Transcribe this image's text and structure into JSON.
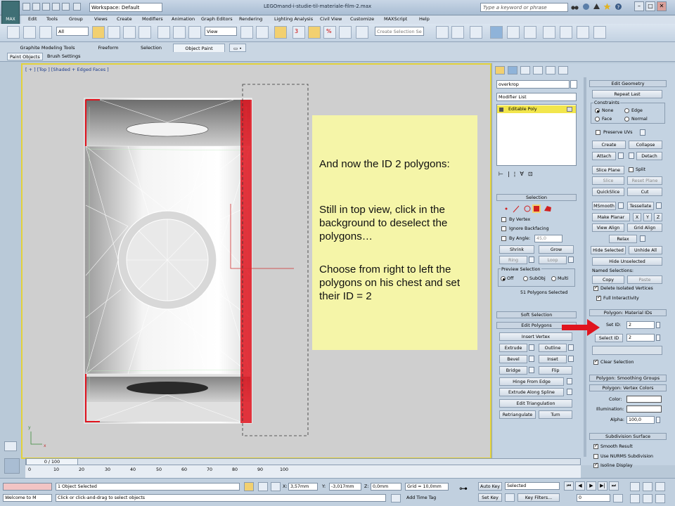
{
  "window": {
    "title": "LEGOmand-i-studie-til-materiale-film-2.max",
    "workspace": "Workspace: Default",
    "search_placeholder": "Type a keyword or phrase",
    "app_label": "MAX"
  },
  "menu": [
    "Edit",
    "Tools",
    "Group",
    "Views",
    "Create",
    "Modifiers",
    "Animation",
    "Graph Editors",
    "Rendering",
    "Lighting Analysis",
    "Civil View",
    "Customize",
    "MAXScript",
    "Help"
  ],
  "toolbar": {
    "filter": "All",
    "coord_system": "View",
    "selection_set_placeholder": "Create Selection Se",
    "snap_value": "3",
    "percent_snap": "%"
  },
  "ribbon": {
    "tabs": [
      "Graphite Modeling Tools",
      "Freeform",
      "Selection",
      "Object Paint"
    ],
    "active_tab": "Object Paint",
    "subtabs": [
      "Paint Objects",
      "Brush Settings"
    ]
  },
  "viewport": {
    "label": "[ + ] [Top ] [Shaded + Edged Faces ]"
  },
  "note": {
    "p1": "And now the ID 2 polygons:",
    "p2": "Still in top view, click in the background to deselect the polygons…",
    "p3": "Choose from right to left the polygons on his chest and set their ID = 2"
  },
  "command_panel": {
    "object_name": "overkrop",
    "modifier_list": "Modifier List",
    "stack_item": "Editable Poly",
    "selection": {
      "title": "Selection",
      "by_vertex": "By Vertex",
      "ignore_backfacing": "Ignore Backfacing",
      "by_angle": "By Angle:",
      "angle_value": "45,0",
      "shrink": "Shrink",
      "grow": "Grow",
      "ring": "Ring",
      "loop": "Loop",
      "preview_title": "Preview Selection",
      "preview_off": "Off",
      "preview_subobj": "SubObj",
      "preview_multi": "Multi",
      "status": "51 Polygons Selected"
    },
    "soft_selection": "Soft Selection",
    "edit_polygons": {
      "title": "Edit Polygons",
      "insert_vertex": "Insert Vertex",
      "extrude": "Extrude",
      "outline": "Outline",
      "bevel": "Bevel",
      "inset": "Inset",
      "bridge": "Bridge",
      "flip": "Flip",
      "hinge": "Hinge From Edge",
      "extrude_spline": "Extrude Along Spline",
      "edit_triangulation": "Edit Triangulation",
      "retriangulate": "Retriangulate",
      "turn": "Turn"
    }
  },
  "rollouts": {
    "edit_geometry": {
      "title": "Edit Geometry",
      "repeat_last": "Repeat Last",
      "constraints": "Constraints",
      "none": "None",
      "edge": "Edge",
      "face": "Face",
      "normal": "Normal",
      "preserve_uvs": "Preserve UVs",
      "create": "Create",
      "collapse": "Collapse",
      "attach": "Attach",
      "detach": "Detach",
      "slice_plane": "Slice Plane",
      "split": "Split",
      "slice": "Slice",
      "reset_plane": "Reset Plane",
      "quickslice": "QuickSlice",
      "cut": "Cut",
      "msmooth": "MSmooth",
      "tessellate": "Tessellate",
      "make_planar": "Make Planar",
      "x": "X",
      "y": "Y",
      "z": "Z",
      "view_align": "View Align",
      "grid_align": "Grid Align",
      "relax": "Relax",
      "hide_selected": "Hide Selected",
      "unhide_all": "Unhide All",
      "hide_unselected": "Hide Unselected",
      "named_selections": "Named Selections:",
      "copy": "Copy",
      "paste": "Paste",
      "delete_isolated": "Delete Isolated Vertices",
      "full_interactivity": "Full Interactivity"
    },
    "material_ids": {
      "title": "Polygon: Material IDs",
      "set_id": "Set ID:",
      "set_id_value": "2",
      "select_id": "Select ID",
      "select_id_value": "2",
      "clear_selection": "Clear Selection"
    },
    "smoothing_groups": "Polygon: Smoothing Groups",
    "vertex_colors": {
      "title": "Polygon: Vertex Colors",
      "color": "Color:",
      "illumination": "Illumination:",
      "alpha": "Alpha:",
      "alpha_value": "100,0"
    },
    "subdivision": {
      "title": "Subdivision Surface",
      "smooth_result": "Smooth Result",
      "use_nurms": "Use NURMS Subdivision",
      "isoline": "Isoline Display"
    }
  },
  "timeline": {
    "frame": "0 / 100",
    "ticks": [
      "0",
      "10",
      "20",
      "30",
      "40",
      "50",
      "60",
      "70",
      "80",
      "90",
      "100"
    ]
  },
  "status": {
    "welcome": "Welcome to M",
    "objects_selected": "1 Object Selected",
    "prompt": "Click or click-and-drag to select objects",
    "x_label": "X:",
    "x_value": "3,57mm",
    "y_label": "Y:",
    "y_value": "-3,017mm",
    "z_label": "Z:",
    "z_value": "0,0mm",
    "grid": "Grid = 10,0mm",
    "add_time_tag": "Add Time Tag",
    "auto_key": "Auto Key",
    "set_key": "Set Key",
    "key_filter_value": "Selected",
    "key_filters": "Key Filters...",
    "frame_value": "0"
  },
  "colors": {
    "accent_red": "#e0141e",
    "viewport_border": "#e3d23a",
    "note_bg": "#f5f5a8"
  }
}
